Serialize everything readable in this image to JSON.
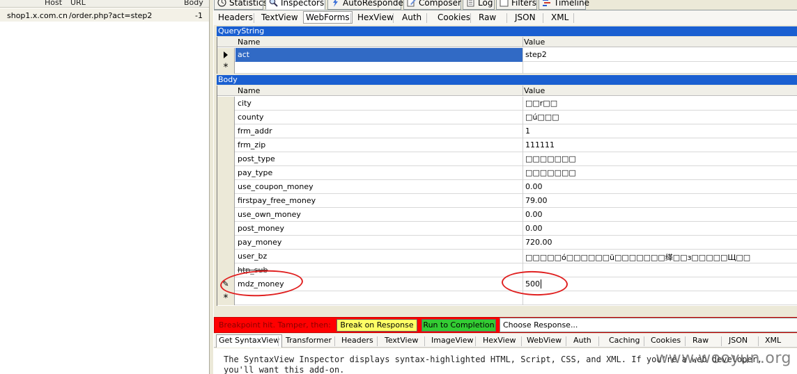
{
  "sessions": {
    "columns": {
      "host": "Host",
      "url": "URL",
      "body": "Body"
    },
    "rows": [
      {
        "host": "shop1.x.com.cn",
        "url": "/order.php?act=step2",
        "body": "-1"
      }
    ]
  },
  "main_tabs": [
    {
      "label": "Statistics",
      "icon": "clock-icon"
    },
    {
      "label": "Inspectors",
      "icon": "magnifier-icon"
    },
    {
      "label": "AutoResponder",
      "icon": "lightning-icon"
    },
    {
      "label": "Composer",
      "icon": "compose-icon"
    },
    {
      "label": "Log",
      "icon": "log-icon"
    },
    {
      "label": "Filters",
      "icon": "checkbox-icon"
    },
    {
      "label": "Timeline",
      "icon": "timeline-icon"
    }
  ],
  "request_tabs": [
    "Headers",
    "TextView",
    "WebForms",
    "HexView",
    "Auth",
    "Cookies",
    "Raw",
    "JSON",
    "XML"
  ],
  "querystring": {
    "title": "QueryString",
    "col_name": "Name",
    "col_value": "Value",
    "rows": [
      {
        "name": "act",
        "value": "step2"
      }
    ],
    "new_row_marker": "*"
  },
  "body_form": {
    "title": "Body",
    "col_name": "Name",
    "col_value": "Value",
    "rows": [
      {
        "name": "city",
        "value": "□□r□□"
      },
      {
        "name": "county",
        "value": "□ú□□□"
      },
      {
        "name": "frm_addr",
        "value": "1"
      },
      {
        "name": "frm_zip",
        "value": "111111"
      },
      {
        "name": "post_type",
        "value": "□□□□□□□"
      },
      {
        "name": "pay_type",
        "value": "□□□□□□□"
      },
      {
        "name": "use_coupon_money",
        "value": "0.00"
      },
      {
        "name": "firstpay_free_money",
        "value": "79.00"
      },
      {
        "name": "use_own_money",
        "value": "0.00"
      },
      {
        "name": "post_money",
        "value": "0.00"
      },
      {
        "name": "pay_money",
        "value": "720.00"
      },
      {
        "name": "user_bz",
        "value": "□□□□□ó□□□□□□ü□□□□□□□缂□□з□□□□□Щ□□"
      },
      {
        "name": "htp_sub",
        "value": ""
      },
      {
        "name": "mdz_money",
        "value": "500"
      }
    ],
    "edit_marker": "✎",
    "new_row_marker": "*"
  },
  "breakpoint": {
    "label": "Breakpoint hit. Tamper, then:",
    "break_button": "Break on Response",
    "run_button": "Run to Completion",
    "choose_response": "Choose Response..."
  },
  "response_tabs": [
    "Get SyntaxView",
    "Transformer",
    "Headers",
    "TextView",
    "ImageView",
    "HexView",
    "WebView",
    "Auth",
    "Caching",
    "Cookies",
    "Raw",
    "JSON",
    "XML"
  ],
  "response_text": {
    "line1": "The SyntaxView Inspector displays syntax-highlighted HTML, Script, CSS, and XML. If you're a web developer,",
    "line2": "you'll want this add-on."
  },
  "watermark": "www.wooyun.org",
  "colors": {
    "section_bar": "#1a5fd1",
    "selected_row": "#316ac5",
    "breakpoint_bar": "#ff0000",
    "break_button": "#ffff66",
    "run_button": "#33cc33",
    "annotation_circle": "#e02020"
  }
}
